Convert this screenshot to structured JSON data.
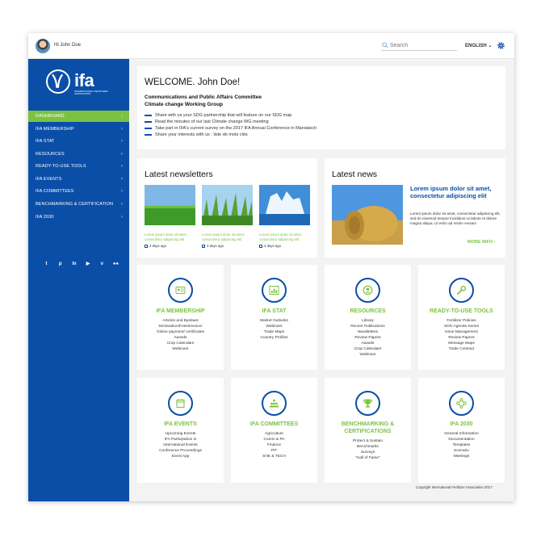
{
  "topbar": {
    "greeting": "Hi John Doe",
    "search_placeholder": "Search",
    "language": "ENGLISH"
  },
  "logo": {
    "text": "ifa",
    "subtitle": "INTERNATIONAL FERTILIZER ASSOCIATION"
  },
  "nav": [
    {
      "label": "DASHBOARD",
      "active": true
    },
    {
      "label": "IFA MEMBERSHIP"
    },
    {
      "label": "IFA STAT"
    },
    {
      "label": "RESOURCES"
    },
    {
      "label": "READY-TO-USE TOOLS"
    },
    {
      "label": "IFA EVENTS"
    },
    {
      "label": "IFA COMMITTEES"
    },
    {
      "label": "BENCHMARKING & CERTIFICATION"
    },
    {
      "label": "IFA 2030"
    }
  ],
  "social": [
    "twitter-icon",
    "pinterest-icon",
    "linkedin-icon",
    "youtube-icon",
    "vimeo-icon",
    "flickr-icon"
  ],
  "welcome": {
    "title": "WELCOME. John Doe!",
    "org_line1": "Communications and Public Affairs Committee",
    "org_line2": "Climate change Working Group",
    "bullets": [
      "Share with us your SDG partnership that will feature on our SDG map",
      "Read the minutes of our last Climate change WG meeting",
      "Take part in IFA's current survey on the 2017 IFA Annual Conference in Marrakech",
      "Share your interests with us : liste de mots clés"
    ]
  },
  "newsletters": {
    "title": "Latest newsletters",
    "items": [
      {
        "caption": "Lorem ipsum dolor sit amet, consectetur adipiscing elit",
        "date": "3 days ago"
      },
      {
        "caption": "Lorem ipsum dolor sit amet, consectetur adipiscing elit",
        "date": "3 days ago"
      },
      {
        "caption": "Lorem ipsum dolor sit amet, consectetur adipiscing elit",
        "date": "3 days ago"
      }
    ]
  },
  "news": {
    "title": "Latest news",
    "headline": "Lorem ipsum dolor sit amet, consectetur adipiscing elit",
    "body": "Lorem ipsum dolor sit amet, consectetur adipiscing elit, sed do eiusmod tempor incididunt ut labore et dolore magna aliqua. Ut enim ad minim veniam",
    "more": "MORE INFO"
  },
  "tiles": [
    {
      "title": "IFA MEMBERSHIP",
      "icon": "id-card-icon",
      "links": [
        "Articles and Byelaws",
        "Declaration/Fees/Invoice/",
        "Online payment/ certificates",
        "Awards",
        "Crop Calendars",
        "Webinars"
      ]
    },
    {
      "title": "IFA STAT",
      "icon": "bar-chart-icon",
      "links": [
        "Market Outlooks",
        "Webinars",
        "Trade Maps",
        "Country Profiles"
      ]
    },
    {
      "title": "RESOURCES",
      "icon": "user-circle-icon",
      "links": [
        "Library",
        "Recent Publications",
        "Newsletters",
        "Review Papers",
        "Awards",
        "Crop Calendars",
        "Webinars"
      ]
    },
    {
      "title": "READY-TO-USE TOOLS",
      "icon": "wrench-icon",
      "links": [
        "Fertilizer Policies",
        "SDG Agenda Series",
        "Issue Management",
        "Review Papers",
        "Message Maps",
        "Trade Contract"
      ]
    },
    {
      "title": "IFA EVENTS",
      "icon": "calendar-icon",
      "links": [
        "Upcoming Events",
        "IFA Participation in",
        "International Events",
        "Conference Proceedings",
        "Event App"
      ]
    },
    {
      "title": "IFA COMMITTEES",
      "icon": "people-icon",
      "links": [
        "Agriculture",
        "Comm & PA",
        "Finance",
        "PIT",
        "SHE & TECH"
      ]
    },
    {
      "title": "BENCHMARKING & CERTIFICATIONS",
      "icon": "trophy-icon",
      "links": [
        "Protect & Sustain",
        "Benchmarks",
        "Surveys",
        "\"Hall of Fame\""
      ]
    },
    {
      "title": "IFA 2030",
      "icon": "network-icon",
      "links": [
        "General Information",
        "Documentation",
        "Templates",
        "Scenario",
        "Meetings"
      ]
    }
  ],
  "copyright": "Copyright International Fertilizer Association 2017",
  "colors": {
    "brand_blue": "#0a4ea7",
    "brand_green": "#7cc242"
  }
}
